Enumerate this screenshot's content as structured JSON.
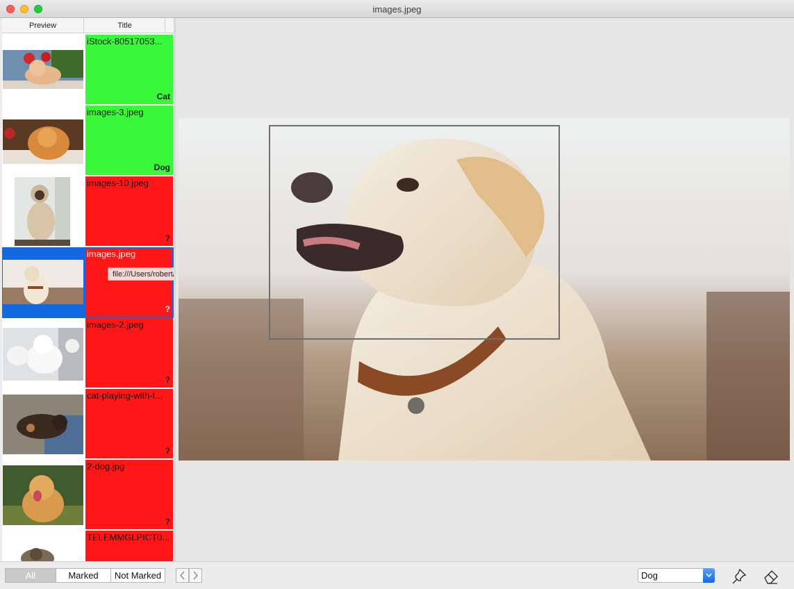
{
  "window": {
    "title": "images.jpeg"
  },
  "list": {
    "columns": {
      "preview": "Preview",
      "title": "Title"
    },
    "rows": [
      {
        "title": "iStock-80517053...",
        "label": "Cat",
        "status": "marked"
      },
      {
        "title": "images-3.jpeg",
        "label": "Dog",
        "status": "marked"
      },
      {
        "title": "images-10.jpeg",
        "label": "?",
        "status": "unmarked"
      },
      {
        "title": "images.jpeg",
        "label": "?",
        "status": "unmarked",
        "selected": true
      },
      {
        "title": "images-2.jpeg",
        "label": "?",
        "status": "unmarked"
      },
      {
        "title": "cat-playing-with-t...",
        "label": "?",
        "status": "unmarked"
      },
      {
        "title": "2-dog.jpg",
        "label": "?",
        "status": "unmarked"
      },
      {
        "title": "TELEMMGLPICT0...",
        "label": "",
        "status": "unmarked"
      }
    ]
  },
  "tooltip": {
    "text": "file:///Users/robert/Desktop/cats_vs_dogs/images.jpeg"
  },
  "filters": {
    "all": "All",
    "marked": "Marked",
    "not_marked": "Not Marked",
    "active": "All"
  },
  "label_select": {
    "value": "Dog"
  },
  "icons": {
    "prev": "chevron-left-icon",
    "next": "chevron-right-icon",
    "pin": "pin-icon",
    "eraser": "eraser-icon"
  },
  "colors": {
    "marked": "#39f83a",
    "unmarked": "#fe1717",
    "selection": "#1469e0"
  }
}
